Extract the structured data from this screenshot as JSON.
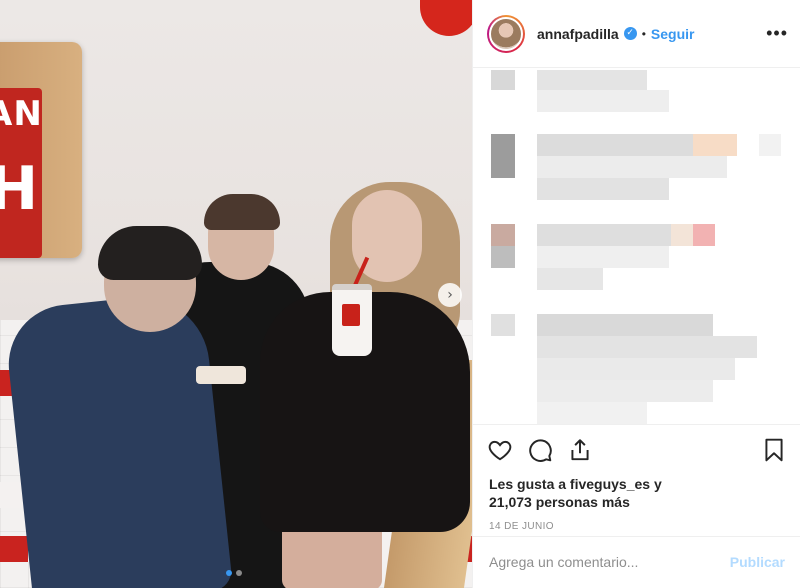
{
  "post": {
    "username": "annafpadilla",
    "verified_symbol": "✓",
    "separator": "•",
    "follow_label": "Seguir",
    "more_label": "•••",
    "likes_line_1": "Les gusta a fiveguys_es y",
    "likes_line_2": "21,073 personas más",
    "date": "14 DE JUNIO",
    "comment_placeholder": "Agrega un comentario...",
    "publish_label": "Publicar"
  },
  "photo": {
    "sign_text_1": "AN",
    "sign_text_2": "H",
    "next_arrow": "›",
    "carousel_total": 2,
    "carousel_active": 1
  },
  "icons": [
    "heart-icon",
    "comment-icon",
    "share-icon",
    "bookmark-icon",
    "verified-icon",
    "next-arrow-icon"
  ],
  "colors": {
    "accent": "#3897f0",
    "publish_disabled": "#b3dbff",
    "text": "#262626",
    "muted": "#8e8e8e",
    "brand_red": "#c8221a"
  }
}
